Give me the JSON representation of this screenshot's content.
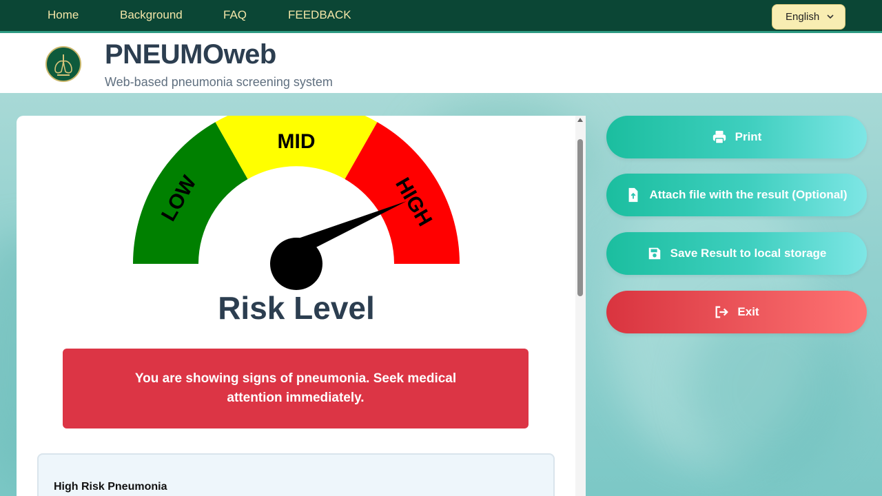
{
  "nav": {
    "links": [
      "Home",
      "Background",
      "FAQ",
      "FEEDBACK"
    ],
    "language": "English"
  },
  "header": {
    "title": "PNEUMOweb",
    "subtitle": "Web-based pneumonia screening system"
  },
  "gauge": {
    "segments": [
      "LOW",
      "MID",
      "HIGH"
    ],
    "colors": {
      "low": "#008000",
      "mid": "#ffff00",
      "high": "#ff0000"
    },
    "needle_level": "HIGH",
    "label": "Risk Level"
  },
  "alert": {
    "message": "You are showing signs of pneumonia. Seek medical attention immediately."
  },
  "info": {
    "title": "High Risk Pneumonia"
  },
  "actions": {
    "print": "Print",
    "attach": "Attach file with the result (Optional)",
    "save": "Save Result to local storage",
    "exit": "Exit"
  }
}
